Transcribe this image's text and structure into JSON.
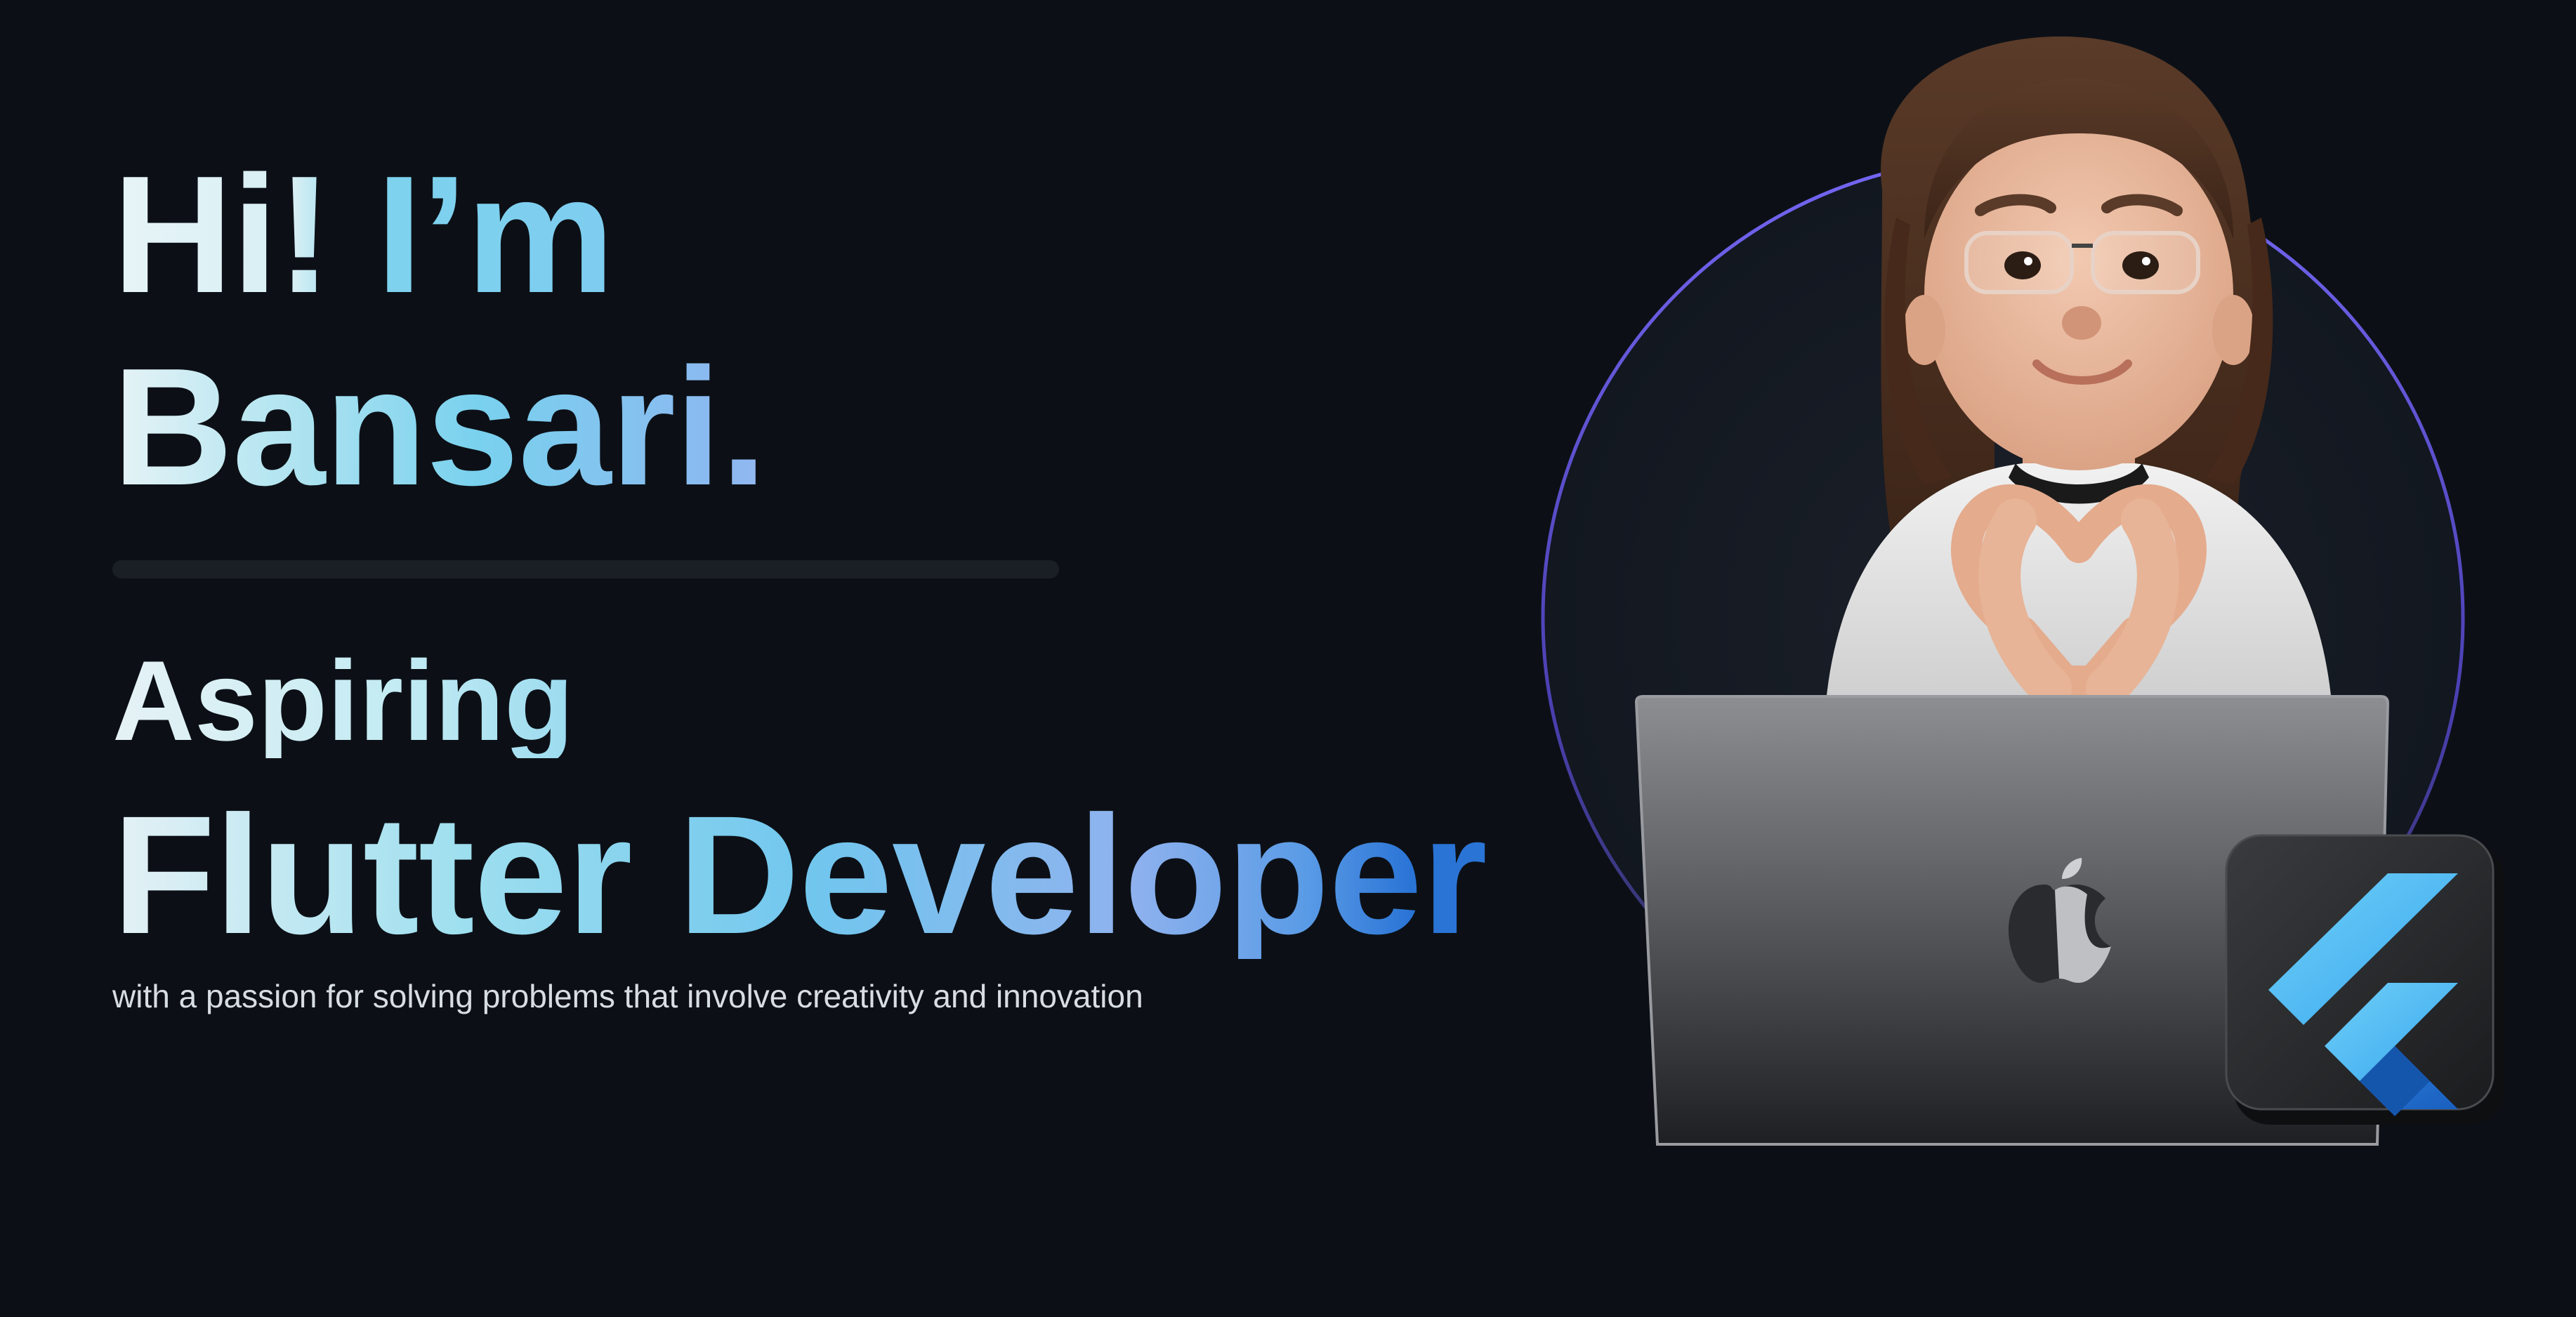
{
  "hero": {
    "greeting_line_1": "Hi! I’m",
    "greeting_line_2": "Bansari.",
    "role_line_1": "Aspiring",
    "role_line_2": "Flutter Developer",
    "tagline": "with a passion for solving problems that involve creativity and innovation"
  },
  "illustration": {
    "avatar_icon": "memoji-heart-hands",
    "laptop_icon": "macbook-apple-logo",
    "badge_icon": "flutter-logo",
    "ring_color": "#6b5cf0",
    "accent_color": "#54b8f5",
    "flutter_dark_blue": "#1f6fd1"
  }
}
